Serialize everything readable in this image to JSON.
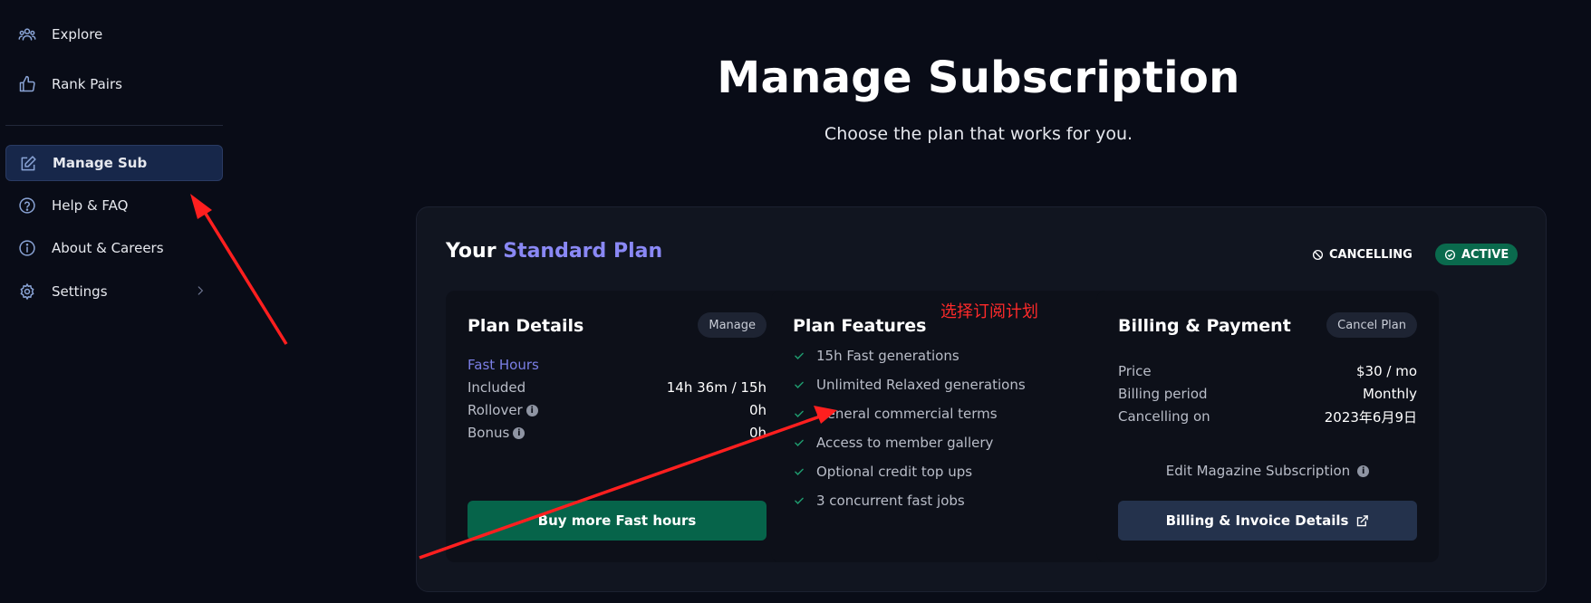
{
  "sidebar": {
    "items": [
      {
        "label": "Explore",
        "icon": "users-icon"
      },
      {
        "label": "Rank Pairs",
        "icon": "thumbs-up-icon"
      },
      {
        "label": "Manage Sub",
        "icon": "edit-icon",
        "active": true
      },
      {
        "label": "Help & FAQ",
        "icon": "help-circle-icon"
      },
      {
        "label": "About & Careers",
        "icon": "info-icon"
      },
      {
        "label": "Settings",
        "icon": "gear-icon"
      }
    ]
  },
  "header": {
    "title": "Manage Subscription",
    "subtitle": "Choose the plan that works for you."
  },
  "plan": {
    "prefix": "Your",
    "name": "Standard Plan",
    "status_cancelling": "CANCELLING",
    "status_active": "ACTIVE"
  },
  "details": {
    "title": "Plan Details",
    "manage_label": "Manage",
    "fast_hours_label": "Fast Hours",
    "rows": [
      {
        "label": "Included",
        "value": "14h 36m / 15h"
      },
      {
        "label": "Rollover",
        "value": "0h"
      },
      {
        "label": "Bonus",
        "value": "0h"
      }
    ],
    "buy_label": "Buy more Fast hours"
  },
  "features": {
    "title": "Plan Features",
    "items": [
      "15h Fast generations",
      "Unlimited Relaxed generations",
      "General commercial terms",
      "Access to member gallery",
      "Optional credit top ups",
      "3 concurrent fast jobs"
    ]
  },
  "billing": {
    "title": "Billing & Payment",
    "cancel_label": "Cancel Plan",
    "rows": [
      {
        "label": "Price",
        "value": "$30 / mo"
      },
      {
        "label": "Billing period",
        "value": "Monthly"
      },
      {
        "label": "Cancelling on",
        "value": "2023年6月9日"
      }
    ],
    "edit_magazine": "Edit Magazine Subscription",
    "invoice_label": "Billing & Invoice Details"
  },
  "annotation": {
    "text": "选择订阅计划",
    "color": "#ff2a2a"
  },
  "colors": {
    "background": "#090c17",
    "accent": "#8a88f5",
    "active_green": "#0a6a4d",
    "buy_button": "#06644a",
    "invoice_button": "#24324c"
  }
}
